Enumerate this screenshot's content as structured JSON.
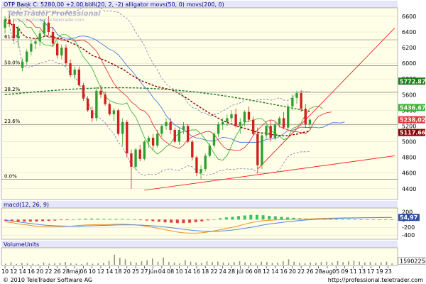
{
  "header": {
    "title": "OTP Bank C: 5280,00 +2,00 boll(20, 2, -2) alligator movs(50, 0) movs(200, 0)",
    "logo": "TeleTrader Professional",
    "logo_url": "http://professional.teletrader.com"
  },
  "footer": {
    "copyright": "© 2010 TeleTrader Software AG",
    "url": "http://professional.teletrader.com"
  },
  "colors": {
    "price_panel_bg": "#FFFFE8",
    "title_bar_bg": "#E6E6FA",
    "axis_bg": "#FFFFFF",
    "up_candle": "#2E9E2E",
    "down_candle": "#D21E1E",
    "boll_band": "#7A7AB4",
    "alligator_jaw": "#4A78E0",
    "alligator_teeth": "#E03A3A",
    "alligator_lips": "#3CB43C",
    "ma50": "#8B0000",
    "ma200": "#1E7A1E",
    "trendline": "#FF2020",
    "macd": "#F09020",
    "signal": "#5088E0",
    "hist_pos": "#3CC060",
    "hist_neg": "#E04040",
    "volume": "#909090"
  },
  "chart_data": [
    {
      "type": "candlestick",
      "title": "OTP Bank C: 5280,00 +2,00 boll(20, 2, -2) alligator movs(50, 0) movs(200, 0)",
      "y_ticks": [
        4400,
        4600,
        4800,
        5000,
        5200,
        5400,
        5600,
        5800,
        6000,
        6200,
        6400,
        6600
      ],
      "ylim": [
        4280,
        6690
      ],
      "fib_levels": [
        {
          "label": "61.8%",
          "value": 6300
        },
        {
          "label": "50.0%",
          "value": 5970
        },
        {
          "label": "38.2%",
          "value": 5630
        },
        {
          "label": "23.6%",
          "value": 5220
        },
        {
          "label": "0.0%",
          "value": 4520
        }
      ],
      "price_labels": [
        {
          "text": "5772.87",
          "value": 5772,
          "color": "#1E7A1E"
        },
        {
          "text": "5436.67",
          "value": 5436,
          "color": "#3CB43C"
        },
        {
          "text": "5238,02",
          "value": 5280,
          "color": "#E03A3A"
        },
        {
          "text": "5117.66",
          "value": 5117,
          "color": "#8B0000"
        }
      ],
      "candles": [
        [
          6450,
          6600,
          6380,
          6560
        ],
        [
          6560,
          6650,
          6480,
          6500
        ],
        [
          6500,
          6560,
          6280,
          6320
        ],
        [
          6320,
          6480,
          6200,
          6450
        ],
        [
          5940,
          6060,
          5900,
          6020
        ],
        [
          6020,
          6180,
          5980,
          6150
        ],
        [
          6150,
          6300,
          6100,
          6250
        ],
        [
          6250,
          6320,
          6180,
          6280
        ],
        [
          6280,
          6420,
          6220,
          6380
        ],
        [
          6380,
          6560,
          6340,
          6520
        ],
        [
          6520,
          6600,
          6360,
          6400
        ],
        [
          6400,
          6460,
          6220,
          6250
        ],
        [
          6250,
          6280,
          6060,
          6100
        ],
        [
          6100,
          6240,
          6050,
          6200
        ],
        [
          6200,
          6240,
          5960,
          6000
        ],
        [
          6000,
          6050,
          5820,
          5850
        ],
        [
          5850,
          5960,
          5800,
          5920
        ],
        [
          5920,
          5960,
          5700,
          5720
        ],
        [
          5720,
          5750,
          5520,
          5550
        ],
        [
          5550,
          5580,
          5380,
          5400
        ],
        [
          5400,
          5450,
          5250,
          5300
        ],
        [
          5300,
          5700,
          5260,
          5650
        ],
        [
          5650,
          5720,
          5560,
          5600
        ],
        [
          5600,
          5640,
          5460,
          5480
        ],
        [
          5480,
          5500,
          5330,
          5350
        ],
        [
          5350,
          5430,
          5260,
          5400
        ],
        [
          5400,
          5420,
          5080,
          5100
        ],
        [
          5100,
          5300,
          4950,
          5250
        ],
        [
          5250,
          5280,
          4800,
          4850
        ],
        [
          4850,
          4900,
          4400,
          4680
        ],
        [
          4680,
          4920,
          4640,
          4900
        ],
        [
          4900,
          4960,
          4750,
          4780
        ],
        [
          4780,
          5020,
          4760,
          5000
        ],
        [
          5000,
          5080,
          4920,
          5050
        ],
        [
          5050,
          5100,
          4900,
          4950
        ],
        [
          4950,
          5150,
          4920,
          5100
        ],
        [
          5100,
          5220,
          5060,
          5200
        ],
        [
          5200,
          5300,
          5150,
          5250
        ],
        [
          5250,
          5300,
          5100,
          5150
        ],
        [
          5150,
          5180,
          4980,
          5000
        ],
        [
          5000,
          5180,
          4960,
          5150
        ],
        [
          5150,
          5250,
          5100,
          5200
        ],
        [
          5200,
          5220,
          4980,
          5000
        ],
        [
          5000,
          5020,
          4760,
          4800
        ],
        [
          4800,
          4820,
          4560,
          4600
        ],
        [
          4600,
          4700,
          4520,
          4650
        ],
        [
          4650,
          4850,
          4620,
          4820
        ],
        [
          4820,
          4980,
          4800,
          4950
        ],
        [
          4950,
          5120,
          4920,
          5100
        ],
        [
          5100,
          5250,
          5060,
          5220
        ],
        [
          5220,
          5300,
          5150,
          5250
        ],
        [
          5250,
          5350,
          5200,
          5300
        ],
        [
          5300,
          5400,
          5250,
          5350
        ],
        [
          5350,
          5420,
          5180,
          5200
        ],
        [
          5200,
          5300,
          5100,
          5250
        ],
        [
          5250,
          5400,
          5200,
          5380
        ],
        [
          5380,
          5450,
          5250,
          5280
        ],
        [
          5280,
          5320,
          5080,
          5100
        ],
        [
          5100,
          5180,
          4600,
          4700
        ],
        [
          4700,
          5120,
          4650,
          5080
        ],
        [
          5080,
          5220,
          5040,
          5200
        ],
        [
          5200,
          5280,
          5000,
          5050
        ],
        [
          5050,
          5250,
          5020,
          5220
        ],
        [
          5220,
          5320,
          5180,
          5300
        ],
        [
          5300,
          5380,
          5160,
          5180
        ],
        [
          5180,
          5480,
          5150,
          5450
        ],
        [
          5450,
          5600,
          5400,
          5560
        ],
        [
          5560,
          5650,
          5480,
          5620
        ],
        [
          5620,
          5660,
          5380,
          5420
        ],
        [
          5420,
          5480,
          5180,
          5220
        ],
        [
          5220,
          5300,
          5160,
          5280
        ]
      ],
      "x_ticks": [
        {
          "i": 0,
          "label": "10"
        },
        {
          "i": 2,
          "label": "12"
        },
        {
          "i": 4,
          "label": "14"
        },
        {
          "i": 6,
          "label": "16"
        },
        {
          "i": 8,
          "label": "20"
        },
        {
          "i": 10,
          "label": "22"
        },
        {
          "i": 12,
          "label": "26"
        },
        {
          "i": 14,
          "label": "28"
        },
        {
          "i": 16,
          "label": "máj"
        },
        {
          "i": 18,
          "label": "06"
        },
        {
          "i": 20,
          "label": "10"
        },
        {
          "i": 22,
          "label": "12"
        },
        {
          "i": 24,
          "label": "14"
        },
        {
          "i": 26,
          "label": "18"
        },
        {
          "i": 28,
          "label": "20"
        },
        {
          "i": 30,
          "label": "25"
        },
        {
          "i": 32,
          "label": "27"
        },
        {
          "i": 34,
          "label": "jún"
        },
        {
          "i": 36,
          "label": "04"
        },
        {
          "i": 38,
          "label": "08"
        },
        {
          "i": 40,
          "label": "10"
        },
        {
          "i": 42,
          "label": "14"
        },
        {
          "i": 44,
          "label": "16"
        },
        {
          "i": 46,
          "label": "18"
        },
        {
          "i": 48,
          "label": "22"
        },
        {
          "i": 50,
          "label": "24"
        },
        {
          "i": 52,
          "label": "28"
        },
        {
          "i": 54,
          "label": "júl"
        },
        {
          "i": 56,
          "label": "06"
        },
        {
          "i": 58,
          "label": "08"
        },
        {
          "i": 60,
          "label": "12"
        },
        {
          "i": 62,
          "label": "14"
        },
        {
          "i": 64,
          "label": "16"
        },
        {
          "i": 66,
          "label": "20"
        },
        {
          "i": 68,
          "label": "22"
        },
        {
          "i": 70,
          "label": "26"
        },
        {
          "i": 72,
          "label": "28"
        },
        {
          "i": 74,
          "label": "aug"
        },
        {
          "i": 76,
          "label": "05"
        },
        {
          "i": 78,
          "label": "09"
        },
        {
          "i": 80,
          "label": "11"
        },
        {
          "i": 82,
          "label": "13"
        },
        {
          "i": 84,
          "label": "17"
        },
        {
          "i": 86,
          "label": "19"
        },
        {
          "i": 88,
          "label": "23"
        }
      ],
      "x_count": 90
    },
    {
      "type": "line",
      "title": "macd(12, 26, 9)",
      "y_ticks": [
        {
          "value": 200,
          "label": "200"
        },
        {
          "value": 0,
          "label": "0"
        },
        {
          "value": -200,
          "label": "-200"
        },
        {
          "value": -400,
          "label": "-400"
        }
      ],
      "ylim": [
        -470,
        260
      ],
      "value_label": "54,97",
      "series": [
        {
          "key": "macd",
          "values": [
            -60,
            -80,
            -110,
            -130,
            -150,
            -170,
            -180,
            -185,
            -185,
            -180,
            -175,
            -165,
            -150,
            -140,
            -135,
            -130,
            -130,
            -125,
            -120,
            -120,
            -125,
            -135,
            -150,
            -175,
            -200,
            -230,
            -260,
            -290,
            -320,
            -340,
            -350,
            -350,
            -340,
            -320,
            -290,
            -260,
            -230,
            -200,
            -160,
            -120,
            -80,
            -50,
            -30,
            -20,
            -10,
            -5,
            0,
            5,
            10,
            15,
            20,
            25,
            30,
            35,
            40,
            42,
            44,
            46,
            48,
            50,
            52,
            54,
            55,
            55
          ]
        },
        {
          "key": "signal",
          "values": [
            -20,
            -40,
            -60,
            -80,
            -100,
            -120,
            -140,
            -150,
            -160,
            -165,
            -168,
            -170,
            -168,
            -165,
            -160,
            -155,
            -150,
            -145,
            -140,
            -138,
            -136,
            -138,
            -142,
            -150,
            -160,
            -175,
            -190,
            -210,
            -230,
            -250,
            -270,
            -285,
            -295,
            -300,
            -300,
            -295,
            -285,
            -270,
            -250,
            -225,
            -200,
            -170,
            -140,
            -115,
            -95,
            -75,
            -55,
            -40,
            -25,
            -12,
            0,
            8,
            15,
            22,
            28,
            33,
            37,
            40,
            43,
            46,
            48,
            50,
            52,
            53
          ]
        }
      ]
    },
    {
      "type": "bar",
      "title": "VolumeUnits",
      "ylim": [
        0,
        4
      ],
      "value_label": "1590225",
      "values": [
        0.3,
        0.6,
        0.2,
        0.5,
        0.4,
        0.3,
        0.2,
        0.6,
        0.3,
        0.4,
        0.5,
        0.7,
        0.4,
        0.3,
        0.2,
        0.6,
        0.3,
        0.4,
        0.5,
        1.0,
        2.6,
        1.8,
        1.4,
        0.8,
        0.6,
        0.9,
        1.2,
        1.6,
        0.8,
        1.9,
        0.7,
        0.6,
        0.4,
        1.2,
        0.8,
        0.6,
        0.5,
        0.9,
        0.7,
        0.8,
        0.6,
        0.5,
        0.7,
        0.9,
        0.6,
        0.5,
        0.4,
        0.8,
        0.7,
        0.5,
        0.6,
        0.9,
        1.4,
        0.8,
        0.5,
        0.4,
        0.6,
        0.5,
        0.7,
        0.8,
        0.6,
        1.0,
        0.7,
        0.9,
        1.1,
        0.8,
        0.6,
        0.7,
        0.5,
        0.6,
        0.8,
        0.4
      ],
      "y_ticks": [
        {
          "value": 1,
          "label": "1590225"
        }
      ]
    }
  ]
}
